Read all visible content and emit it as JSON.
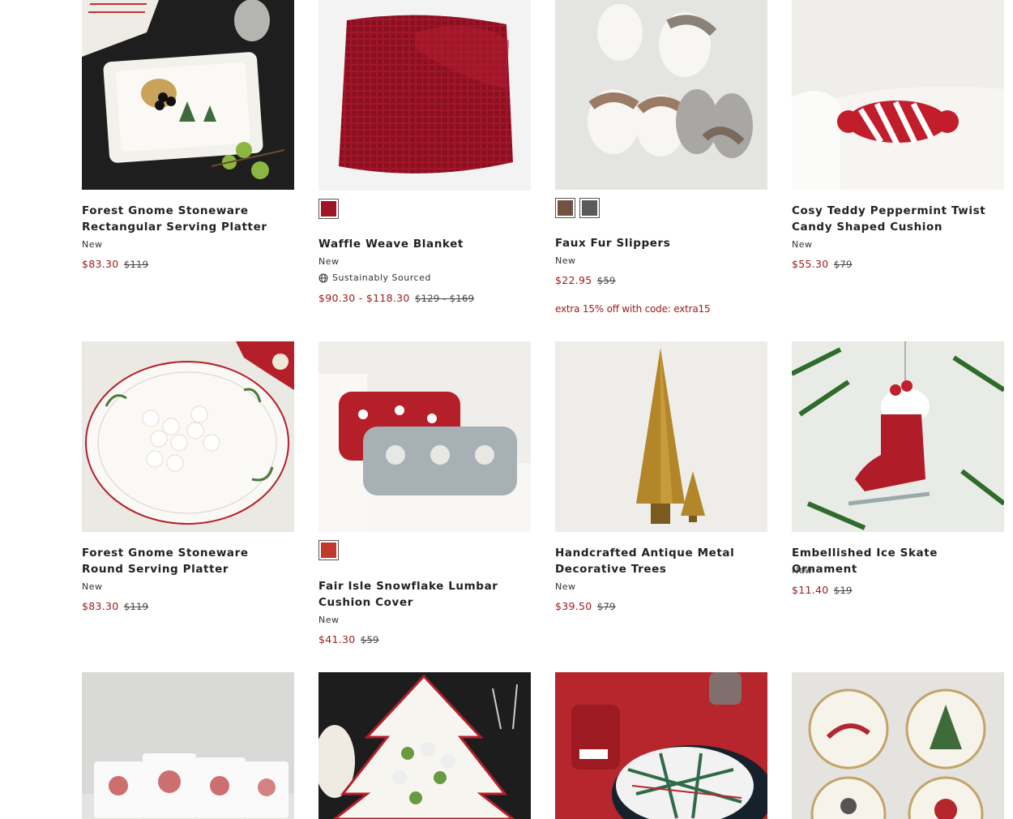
{
  "products": [
    {
      "title": "Forest Gnome Stoneware Rectangular Serving Platter",
      "badge": "New",
      "sale": "$83.30",
      "orig": "$119"
    },
    {
      "title": "Waffle Weave Blanket",
      "badge": "New",
      "eco": "Sustainably Sourced",
      "sale": "$90.30 - $118.30",
      "orig": "$129 - $169",
      "swatches": [
        "#9e1424"
      ]
    },
    {
      "title": "Faux Fur Slippers",
      "badge": "New",
      "sale": "$22.95",
      "orig": "$59",
      "promo": "extra 15% off with code: extra15",
      "swatches": [
        "#6f5240",
        "#5a5a5a"
      ]
    },
    {
      "title": "Cosy Teddy Peppermint Twist Candy Shaped Cushion",
      "badge": "New",
      "sale": "$55.30",
      "orig": "$79"
    },
    {
      "title": "Forest Gnome Stoneware Round Serving Platter",
      "badge": "New",
      "sale": "$83.30",
      "orig": "$119"
    },
    {
      "title": "Fair Isle Snowflake Lumbar Cushion Cover",
      "badge": "New",
      "sale": "$41.30",
      "orig": "$59",
      "swatches": [
        "#c0392b"
      ]
    },
    {
      "title": "Handcrafted Antique Metal Decorative Trees",
      "badge": "New",
      "sale": "$39.50",
      "orig": "$79"
    },
    {
      "title": "Embellished Ice Skate Ornament",
      "badge": "New",
      "sale": "$11.40",
      "orig": "$19"
    }
  ],
  "colors": {
    "sale": "#a01b1b",
    "text": "#222222"
  }
}
